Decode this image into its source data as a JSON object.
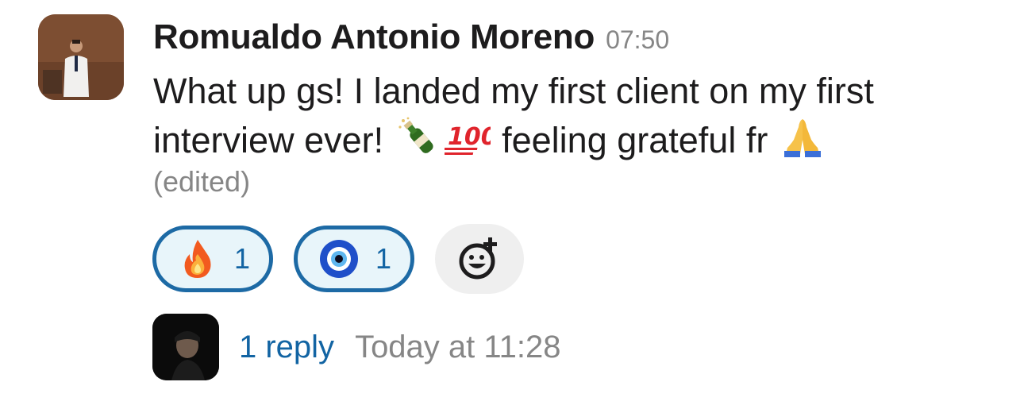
{
  "message": {
    "author": "Romualdo Antonio Moreno",
    "timestamp": "07:50",
    "text_parts": {
      "line_start": "What up gs! I landed my first client on my first interview ever! ",
      "middle": " feeling grateful fr "
    },
    "emojis_in_text": [
      "bottle-with-popping-cork-icon",
      "hundred-points-icon",
      "folded-hands-icon"
    ],
    "edited_label": "(edited)"
  },
  "reactions": [
    {
      "emoji": "fire-icon",
      "count": "1"
    },
    {
      "emoji": "nazar-amulet-icon",
      "count": "1"
    }
  ],
  "thread": {
    "reply_label": "1 reply",
    "reply_time": "Today at 11:28"
  },
  "colors": {
    "link": "#1264a3",
    "reaction_border": "#1d6aa5",
    "reaction_bg": "#e8f5fa",
    "muted": "#868686"
  }
}
